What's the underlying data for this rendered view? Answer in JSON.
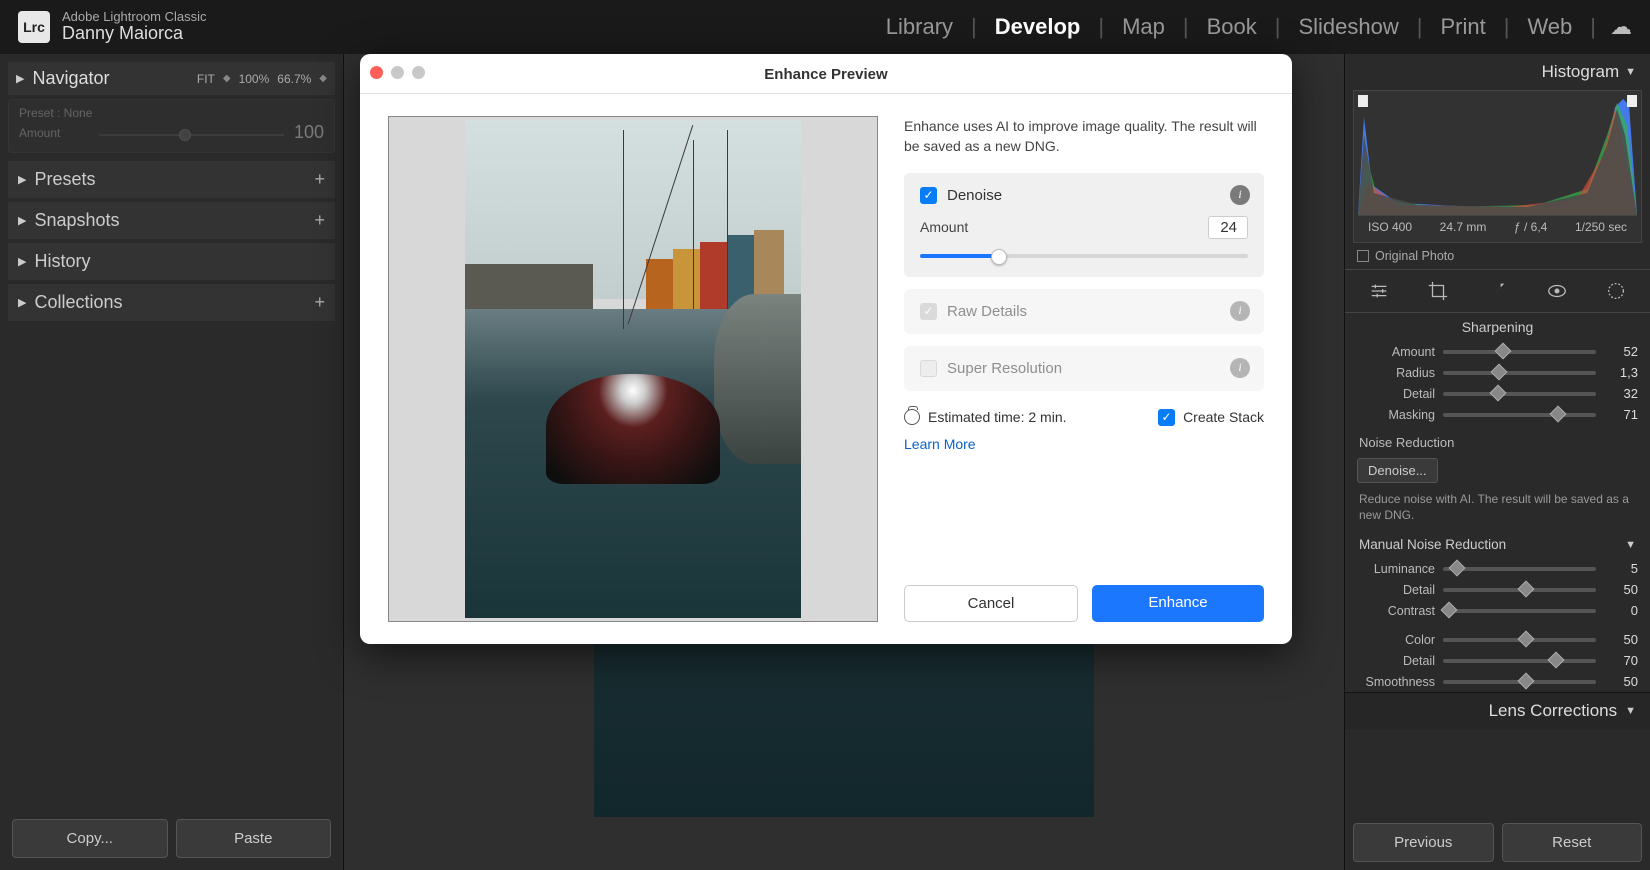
{
  "app": {
    "name": "Adobe Lightroom Classic",
    "user": "Danny Maiorca",
    "logo": "Lrc"
  },
  "modules": {
    "items": [
      "Library",
      "Develop",
      "Map",
      "Book",
      "Slideshow",
      "Print",
      "Web"
    ],
    "active": "Develop"
  },
  "left": {
    "navigator": {
      "title": "Navigator",
      "fit": "FIT",
      "p100": "100%",
      "p66": "66.7%"
    },
    "preset_box": {
      "line1": "Preset : None",
      "line2": "Amount",
      "value": "100"
    },
    "accordions": [
      {
        "label": "Presets"
      },
      {
        "label": "Snapshots"
      },
      {
        "label": "History"
      },
      {
        "label": "Collections"
      }
    ],
    "buttons": {
      "copy": "Copy...",
      "paste": "Paste"
    }
  },
  "right": {
    "histogram": {
      "title": "Histogram",
      "iso": "ISO 400",
      "focal": "24.7 mm",
      "aperture": "ƒ / 6,4",
      "shutter": "1/250 sec",
      "original": "Original Photo"
    },
    "sharpening": {
      "title": "Sharpening",
      "amount": {
        "label": "Amount",
        "value": "52",
        "pct": 35
      },
      "radius": {
        "label": "Radius",
        "value": "1,3",
        "pct": 33
      },
      "detail": {
        "label": "Detail",
        "value": "32",
        "pct": 32
      },
      "masking": {
        "label": "Masking",
        "value": "71",
        "pct": 71
      }
    },
    "noise": {
      "title": "Noise Reduction",
      "denoise_btn": "Denoise...",
      "desc": "Reduce noise with AI. The result will be saved as a new DNG."
    },
    "manual": {
      "title": "Manual Noise Reduction",
      "luminance": {
        "label": "Luminance",
        "value": "5",
        "pct": 5
      },
      "lum_detail": {
        "label": "Detail",
        "value": "50",
        "pct": 50
      },
      "contrast": {
        "label": "Contrast",
        "value": "0",
        "pct": 0
      },
      "color": {
        "label": "Color",
        "value": "50",
        "pct": 50
      },
      "col_detail": {
        "label": "Detail",
        "value": "70",
        "pct": 70
      },
      "smoothness": {
        "label": "Smoothness",
        "value": "50",
        "pct": 50
      }
    },
    "lens": {
      "title": "Lens Corrections"
    },
    "buttons": {
      "prev": "Previous",
      "reset": "Reset"
    }
  },
  "modal": {
    "title": "Enhance Preview",
    "desc": "Enhance uses AI to improve image quality. The result will be saved as a new DNG.",
    "denoise": {
      "label": "Denoise",
      "amount_label": "Amount",
      "amount_value": "24"
    },
    "raw": {
      "label": "Raw Details"
    },
    "super": {
      "label": "Super Resolution"
    },
    "time": "Estimated time: 2 min.",
    "stack": "Create Stack",
    "learn": "Learn More",
    "cancel": "Cancel",
    "enhance": "Enhance"
  }
}
